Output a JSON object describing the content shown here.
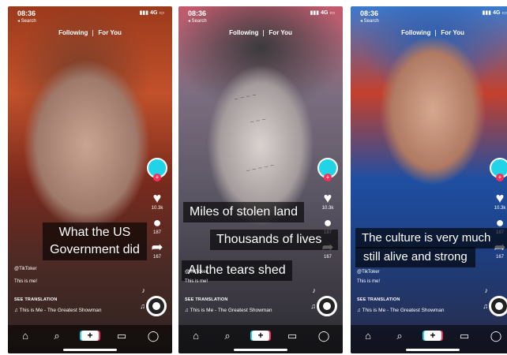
{
  "status": {
    "time": "08:36",
    "right": "4G"
  },
  "back_label": "◂ Search",
  "tabs": {
    "following": "Following",
    "for_you": "For You"
  },
  "rail": {
    "likes": "10.3k",
    "comments": "187",
    "shares": "167"
  },
  "username": "@TikToker",
  "description": "This is me!",
  "see_translation": "SEE TRANSLATION",
  "music": "♫  This is Me - The Greatest Showman",
  "phones": [
    {
      "captions": [
        "What the US",
        "Government did"
      ]
    },
    {
      "captions": [
        "Miles of stolen land",
        "Thousands of lives",
        "All the tears shed"
      ]
    },
    {
      "captions": [
        "The culture is very much",
        "still alive and strong"
      ]
    }
  ],
  "nav": {
    "home": "⌂",
    "search": "⌕",
    "add": "+",
    "inbox": "▭",
    "profile": "◯"
  }
}
